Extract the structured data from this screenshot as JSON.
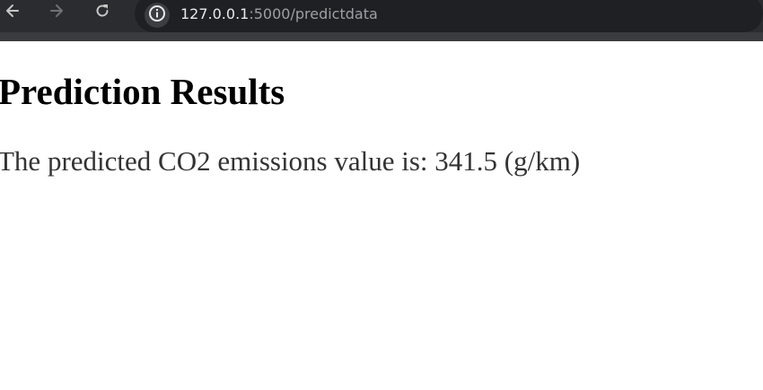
{
  "browser": {
    "url_host": "127.0.0.1",
    "url_path": ":5000/predictdata",
    "icons": {
      "back": "arrow-left-icon",
      "forward": "arrow-right-icon",
      "reload": "reload-icon",
      "site_info": "info-icon"
    },
    "colors": {
      "toolbar": "#2b2c2f",
      "address_bar": "#1f2023",
      "url_host": "#e8eaed",
      "url_path": "#9aa0a6"
    }
  },
  "page": {
    "title": "Prediction Results",
    "result_text": "The predicted CO2 emissions value is: 341.5 (g/km)",
    "colors": {
      "title": "#000000",
      "text": "#333333",
      "background": "#ffffff"
    }
  }
}
